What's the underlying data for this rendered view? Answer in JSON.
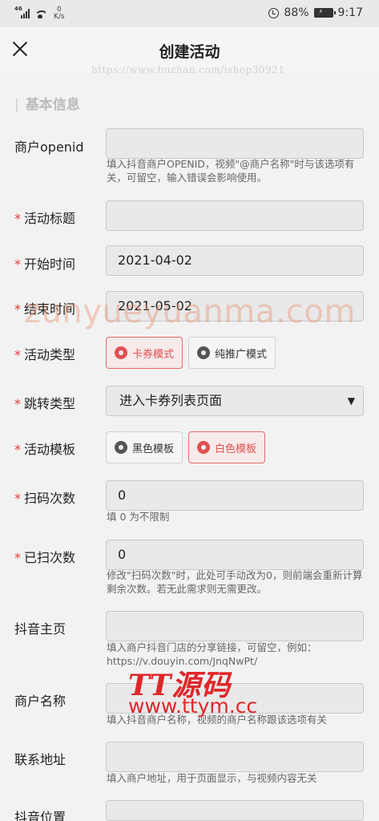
{
  "status_bar": {
    "signal_label": "46",
    "net_speed_value": "0",
    "net_speed_unit": "K/s",
    "battery_percent": "88%",
    "time": "9:17"
  },
  "header": {
    "title": "创建活动"
  },
  "watermarks": {
    "url": "https://www.huzhan.com/ishop30921",
    "brand": "zunyueyuanma.com",
    "logo": "TT源码",
    "logo_url": "www.ttym.cc"
  },
  "section": {
    "title": "基本信息"
  },
  "form": {
    "merchant_openid": {
      "label": "商户openid",
      "value": "",
      "help": "填入抖音商户OPENID，视频\"@商户名称\"时与该选项有关，可留空，输入错误会影响使用。"
    },
    "activity_title": {
      "label": "活动标题",
      "value": ""
    },
    "start_time": {
      "label": "开始时间",
      "value": "2021-04-02"
    },
    "end_time": {
      "label": "结束时间",
      "value": "2021-05-02"
    },
    "activity_type": {
      "label": "活动类型",
      "options": [
        "卡券模式",
        "纯推广模式"
      ],
      "selected": "卡券模式"
    },
    "jump_type": {
      "label": "跳转类型",
      "value": "进入卡券列表页面",
      "arrow": "▼"
    },
    "activity_template": {
      "label": "活动模板",
      "options": [
        "黑色模板",
        "白色模板"
      ],
      "selected": "白色模板"
    },
    "scan_count": {
      "label": "扫码次数",
      "value": "0",
      "help": "填 0 为不限制"
    },
    "scanned_count": {
      "label": "已扫次数",
      "value": "0",
      "help": "修改\"扫码次数\"时，此处可手动改为0，则前端会重新计算剩余次数。若无此需求则无需更改。"
    },
    "douyin_home": {
      "label": "抖音主页",
      "value": "",
      "help": "填入商户抖音门店的分享链接，可留空，例如：https://v.douyin.com/JnqNwPt/"
    },
    "merchant_name": {
      "label": "商户名称",
      "value": "",
      "help": "填入抖音商户名称，视频的商户名称跟该选项有关"
    },
    "contact_address": {
      "label": "联系地址",
      "value": "",
      "help": "填入商户地址，用于页面显示，与视频内容无关"
    },
    "douyin_location": {
      "label": "抖音位置",
      "value": ""
    }
  },
  "colors": {
    "required": "#e03a3a",
    "active_radio": "#e05050",
    "input_bg": "#e9e9e9"
  }
}
